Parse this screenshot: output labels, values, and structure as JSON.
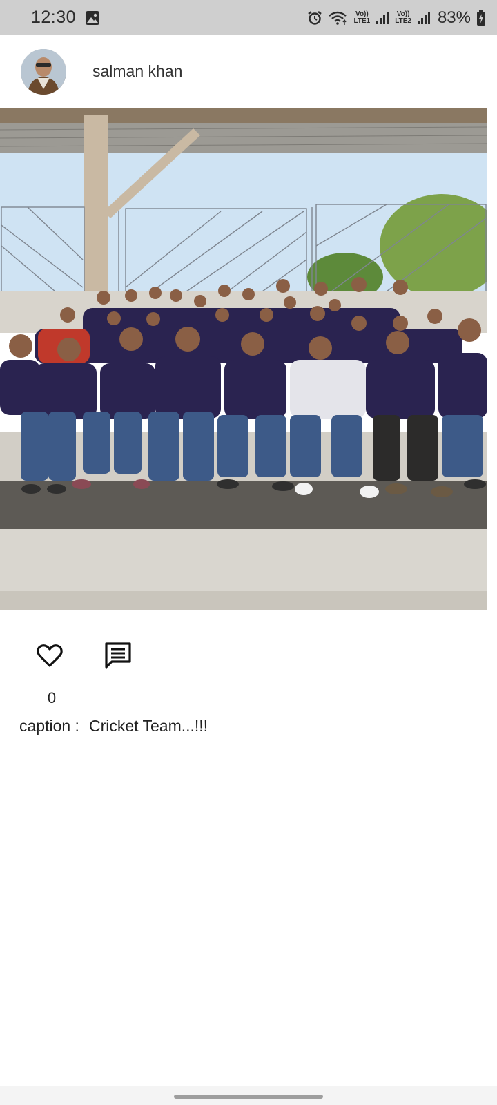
{
  "status_bar": {
    "time": "12:30",
    "sim1_label_top": "Vo))",
    "sim1_label_bottom": "LTE1",
    "sim2_label_top": "Vo))",
    "sim2_label_bottom": "LTE2",
    "battery": "83%",
    "icons": [
      "gallery-icon",
      "alarm-icon",
      "wifi-icon",
      "signal-icon",
      "signal-icon",
      "battery-charging-icon"
    ]
  },
  "post": {
    "username": "salman khan",
    "like_count": "0",
    "caption_label": "caption :",
    "caption_text": "Cricket Team...!!!",
    "icons": [
      "heart-outline-icon",
      "comment-icon"
    ]
  },
  "colors": {
    "status_bar_bg": "#cfcfcf",
    "jersey": "#2a2350",
    "sky": "#cfe3f3"
  }
}
